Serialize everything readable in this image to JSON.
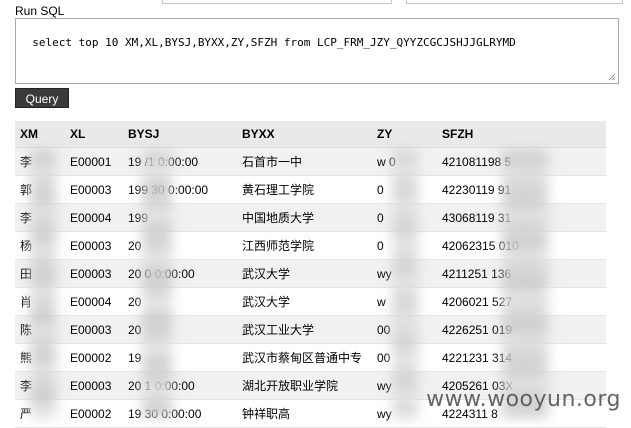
{
  "panel": {
    "title": "Run SQL",
    "sql_text": "select top 10 XM,XL,BYSJ,BYXX,ZY,SFZH from LCP_FRM_JZY_QYYZCGCJSHJJGLRYMD",
    "query_label": "Query"
  },
  "table": {
    "columns": [
      "XM",
      "XL",
      "BYSJ",
      "BYXX",
      "ZY",
      "SFZH"
    ],
    "rows": [
      [
        "李",
        "E00001",
        "19  /1 0:00:00",
        "石首市一中",
        "w   0",
        "421081198      5"
      ],
      [
        "郭",
        "E00003",
        "199   30 0:00:00",
        "黄石理工学院",
        "0",
        "42230119       91"
      ],
      [
        "李",
        "E00004",
        "199",
        "中国地质大学",
        "0",
        "43068119       31"
      ],
      [
        "杨",
        "E00003",
        "20",
        "江西师范学院",
        "0",
        "42062315       010"
      ],
      [
        "田",
        "E00003",
        "20     0 0:00:00",
        "武汉大学",
        "wy",
        "4211251       136"
      ],
      [
        "肖",
        "E00004",
        "20",
        "武汉大学",
        "w",
        "4206021       527"
      ],
      [
        "陈",
        "E00003",
        "20",
        "武汉工业大学",
        "00",
        "4226251       019"
      ],
      [
        "熊",
        "E00002",
        "19",
        "武汉市蔡甸区普通中专",
        "00",
        "4221231       314"
      ],
      [
        "李",
        "E00003",
        "20     1 0:00:00",
        "湖北开放职业学院",
        "wy",
        "4205261       03X"
      ],
      [
        "严",
        "E00002",
        "19   30 0:00:00",
        "钟祥职高",
        "wy",
        "4224311      8"
      ]
    ]
  },
  "watermark": "www.wooyun.org"
}
